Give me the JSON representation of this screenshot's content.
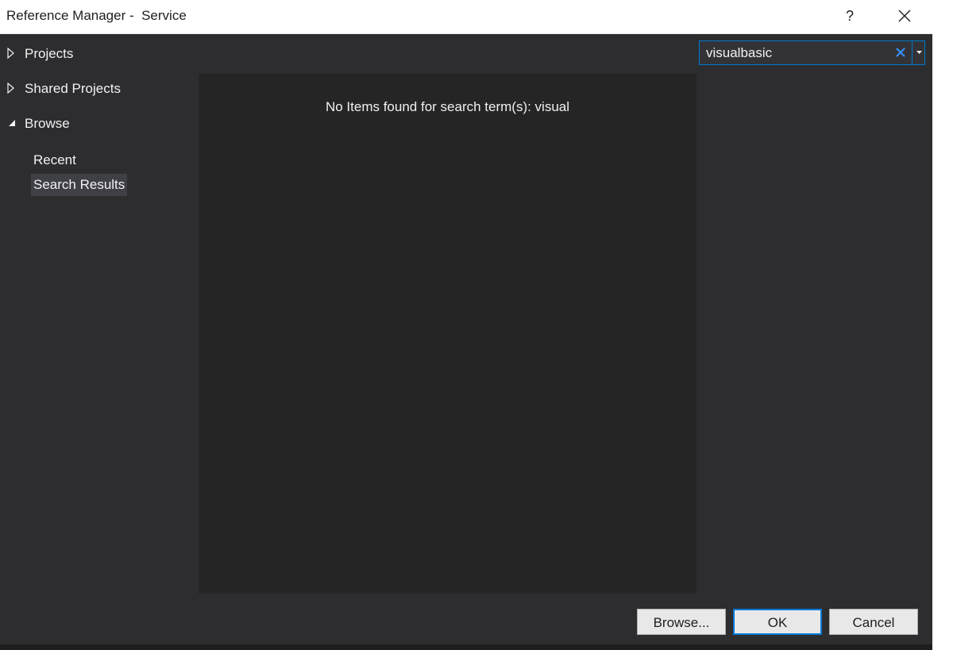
{
  "window": {
    "title": "Reference Manager -  Service",
    "help_label": "?"
  },
  "sidebar": {
    "items": [
      {
        "label": "Projects",
        "expanded": false
      },
      {
        "label": "Shared Projects",
        "expanded": false
      },
      {
        "label": "Browse",
        "expanded": true
      }
    ],
    "browse_children": [
      {
        "label": "Recent",
        "selected": false
      },
      {
        "label": "Search Results",
        "selected": true
      }
    ]
  },
  "search": {
    "value": "visualbasic"
  },
  "content": {
    "empty_message": "No Items found for search term(s): visual"
  },
  "footer": {
    "browse_label": "Browse...",
    "ok_label": "OK",
    "cancel_label": "Cancel"
  },
  "colors": {
    "background": "#2d2d30",
    "content_background": "#252526",
    "accent": "#007acc",
    "selected_item": "#3f3f46",
    "text": "#f1f1f1"
  },
  "icons": {
    "close": "close-icon",
    "collapsed": "triangle-right-icon",
    "expanded": "triangle-down-icon",
    "clear": "clear-x-icon",
    "dropdown": "chevron-down-icon"
  }
}
